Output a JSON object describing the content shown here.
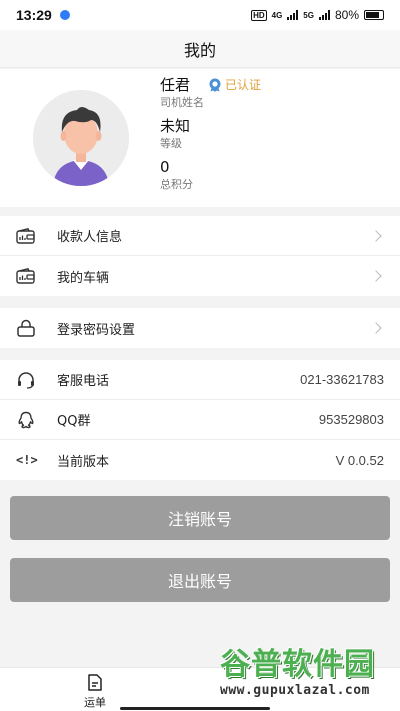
{
  "statusbar": {
    "time": "13:29",
    "net_tag": "HD",
    "net_4g": "4G",
    "net_5g": "5G",
    "battery": "80%"
  },
  "header": {
    "title": "我的"
  },
  "profile": {
    "name": "任君",
    "name_caption": "司机姓名",
    "verified_label": "已认证",
    "level": "未知",
    "level_caption": "等级",
    "points": "0",
    "points_caption": "总积分"
  },
  "menu_payment": [
    {
      "label": "收款人信息",
      "icon": "wallet-icon"
    },
    {
      "label": "我的车辆",
      "icon": "vehicle-icon"
    }
  ],
  "menu_security": [
    {
      "label": "登录密码设置",
      "icon": "lock-icon"
    }
  ],
  "menu_info": [
    {
      "label": "客服电话",
      "value": "021-33621783",
      "icon": "headset-icon"
    },
    {
      "label": "QQ群",
      "value": "953529803",
      "icon": "qq-icon"
    },
    {
      "label": "当前版本",
      "value": "V 0.0.52",
      "icon": "code-icon"
    }
  ],
  "buttons": {
    "cancel_account": "注销账号",
    "logout": "退出账号"
  },
  "tabbar": {
    "tab_orders": "运单"
  },
  "watermark": {
    "brand": "谷普软件园",
    "url": "www.gupuxlazal.com"
  },
  "colors": {
    "verified": "#e0a23a",
    "button_bg": "#9d9d9d",
    "watermark_green": "#4caf50"
  }
}
